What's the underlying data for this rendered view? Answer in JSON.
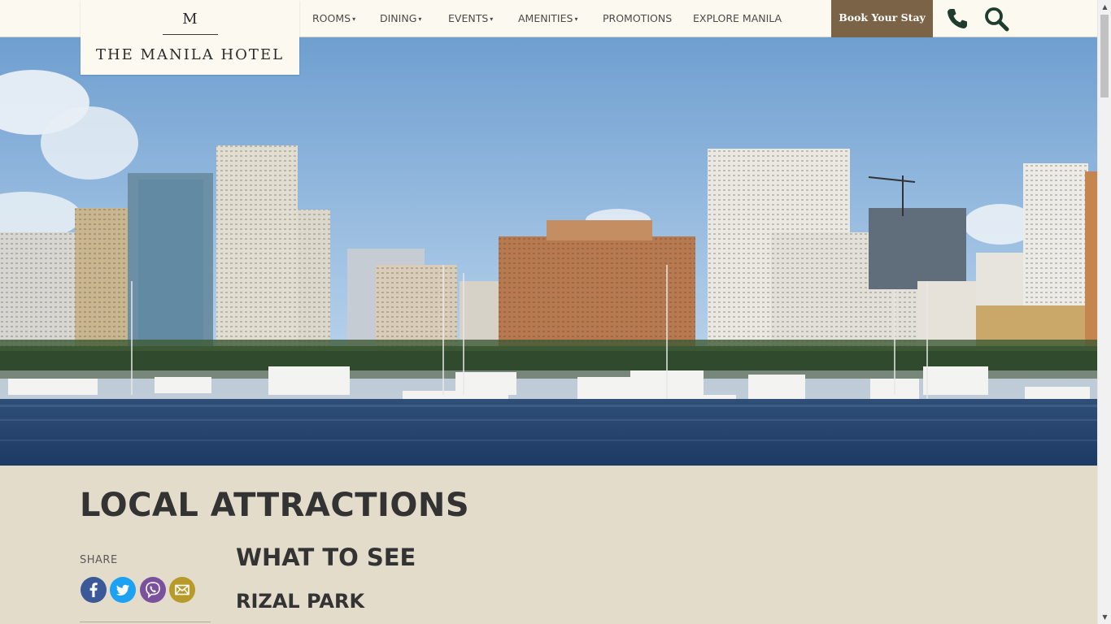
{
  "brand": {
    "monogram": "M",
    "name": "THE MANILA HOTEL"
  },
  "nav": {
    "items": [
      {
        "label": "ROOMS",
        "has_dropdown": true
      },
      {
        "label": "DINING",
        "has_dropdown": true
      },
      {
        "label": "EVENTS",
        "has_dropdown": true
      },
      {
        "label": "AMENITIES",
        "has_dropdown": true
      },
      {
        "label": "PROMOTIONS",
        "has_dropdown": false
      },
      {
        "label": "EXPLORE MANILA",
        "has_dropdown": false
      }
    ],
    "dropdown_caret": "▾",
    "book_label": "Book Your Stay",
    "icons": [
      "phone-icon",
      "search-icon"
    ]
  },
  "hero": {
    "image": "manila-bay-skyline-with-yachts"
  },
  "content": {
    "page_title": "LOCAL ATTRACTIONS",
    "share_label": "SHARE",
    "share_icons": [
      "facebook-icon",
      "twitter-icon",
      "viber-icon",
      "email-icon"
    ],
    "section_title": "WHAT TO SEE",
    "subsection_title": "RIZAL PARK"
  },
  "colors": {
    "header_bg": "#fcfaf0",
    "accent_brown": "#7a6346",
    "icon_dark_green": "#1f3d2e",
    "content_bg": "#e3dccb",
    "facebook": "#3b5998",
    "twitter": "#1da1f2",
    "viber": "#7b519d",
    "email": "#b89a2b"
  }
}
